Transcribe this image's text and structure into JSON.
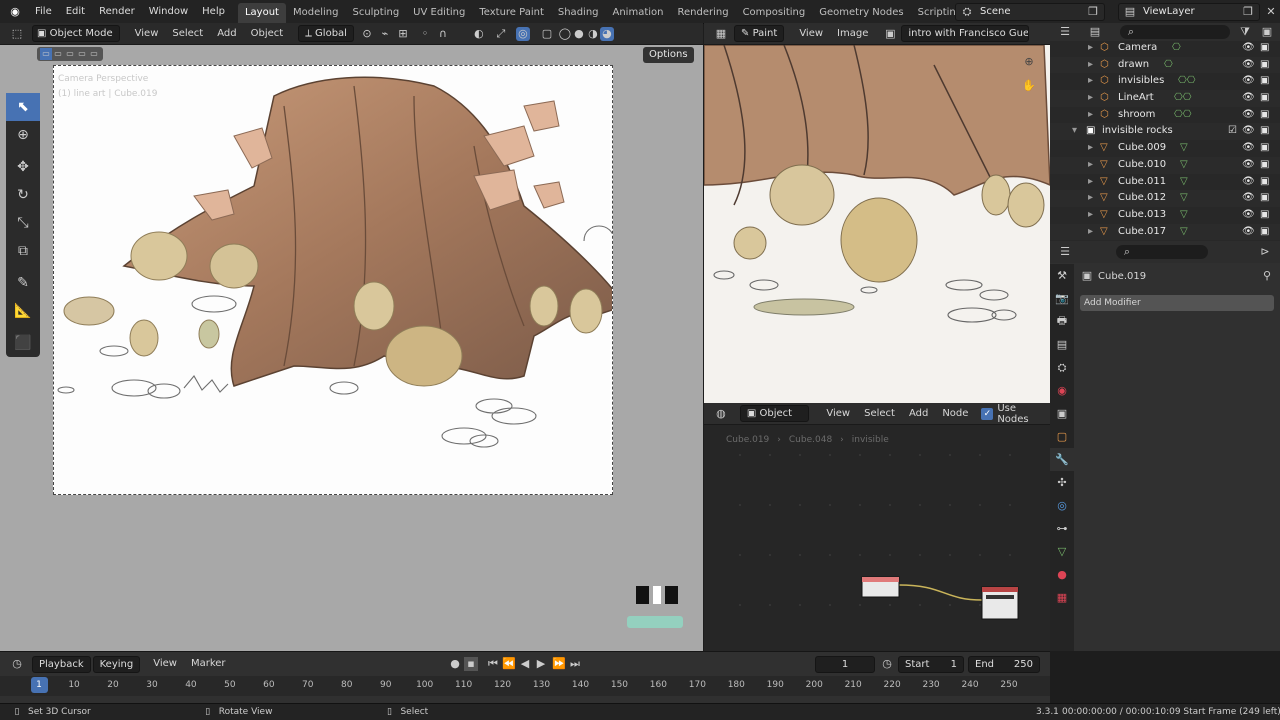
{
  "topbar": {
    "menus": [
      "File",
      "Edit",
      "Render",
      "Window",
      "Help"
    ],
    "workspaces": [
      "Layout",
      "Modeling",
      "Sculpting",
      "UV Editing",
      "Texture Paint",
      "Shading",
      "Animation",
      "Rendering",
      "Compositing",
      "Geometry Nodes",
      "Scripting"
    ],
    "active_workspace": "Layout",
    "add_workspace": "+",
    "scene": "Scene",
    "view_layer": "ViewLayer"
  },
  "viewport": {
    "mode": "Object Mode",
    "menus": [
      "View",
      "Select",
      "Add",
      "Object"
    ],
    "orientation": "Global",
    "options_label": "Options",
    "overlay_text_1": "Camera Perspective",
    "overlay_text_2": "(1) line art | Cube.019"
  },
  "image_editor": {
    "mode": "Paint",
    "menus": [
      "View",
      "Image"
    ],
    "image_name": "intro with Francisco Guerrero..."
  },
  "node_editor": {
    "type": "Object",
    "menus": [
      "View",
      "Select",
      "Add",
      "Node"
    ],
    "use_nodes_label": "Use Nodes",
    "use_nodes_checked": true,
    "breadcrumb": [
      "Cube.019",
      "Cube.048",
      "invisible"
    ]
  },
  "outliner": {
    "rows": [
      {
        "name": "Camera",
        "type": "object",
        "indent": 1
      },
      {
        "name": "drawn",
        "type": "object",
        "indent": 1
      },
      {
        "name": "invisibles",
        "type": "object",
        "indent": 1
      },
      {
        "name": "LineArt",
        "type": "object",
        "indent": 1
      },
      {
        "name": "shroom",
        "type": "object",
        "indent": 1
      },
      {
        "name": "invisible rocks",
        "type": "collection",
        "indent": 0
      },
      {
        "name": "Cube.009",
        "type": "mesh",
        "indent": 1
      },
      {
        "name": "Cube.010",
        "type": "mesh",
        "indent": 1
      },
      {
        "name": "Cube.011",
        "type": "mesh",
        "indent": 1
      },
      {
        "name": "Cube.012",
        "type": "mesh",
        "indent": 1
      },
      {
        "name": "Cube.013",
        "type": "mesh",
        "indent": 1
      },
      {
        "name": "Cube.017",
        "type": "mesh",
        "indent": 1
      }
    ]
  },
  "properties": {
    "object_name": "Cube.019",
    "add_modifier_label": "Add Modifier"
  },
  "timeline": {
    "menus": [
      "Playback",
      "Keying",
      "View",
      "Marker"
    ],
    "current_frame": "1",
    "start_label": "Start",
    "start_value": "1",
    "end_label": "End",
    "end_value": "250",
    "ticks": [
      "1",
      "10",
      "20",
      "30",
      "40",
      "50",
      "60",
      "70",
      "80",
      "90",
      "100",
      "110",
      "120",
      "130",
      "140",
      "150",
      "160",
      "170",
      "180",
      "190",
      "200",
      "210",
      "220",
      "230",
      "240",
      "250"
    ]
  },
  "status": {
    "hint1": "Set 3D Cursor",
    "hint2": "Rotate View",
    "hint3": "Select",
    "version": "3.3.1",
    "info": "00:00:00:00 / 00:00:10:09  Start Frame (249 left)"
  },
  "colors": {
    "accent": "#4772b3",
    "active_frame": "#4772b3",
    "orange_mesh": "#e89a4b",
    "green_data": "#78b86b"
  }
}
